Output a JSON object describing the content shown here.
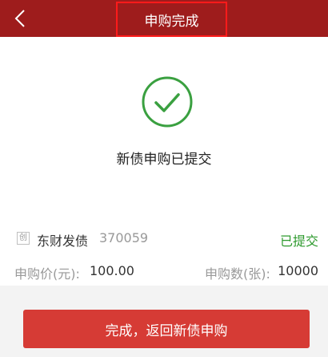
{
  "header": {
    "title": "申购完成",
    "back_icon": "chevron-left-icon"
  },
  "result": {
    "message": "新债申购已提交",
    "icon": "check-circle-icon",
    "accent_color": "#3aa040"
  },
  "bond": {
    "icon_char": "创",
    "name": "东财发债",
    "code": "370059",
    "status": "已提交",
    "price_label": "申购价(元):",
    "price_value": "100.00",
    "quantity_label": "申购数(张):",
    "quantity_value": "10000"
  },
  "footer": {
    "button_label": "完成，返回新债申购"
  },
  "colors": {
    "header_bg": "#9e1c1c",
    "button_bg": "#d63b35",
    "status_green": "#2e9a2e"
  }
}
